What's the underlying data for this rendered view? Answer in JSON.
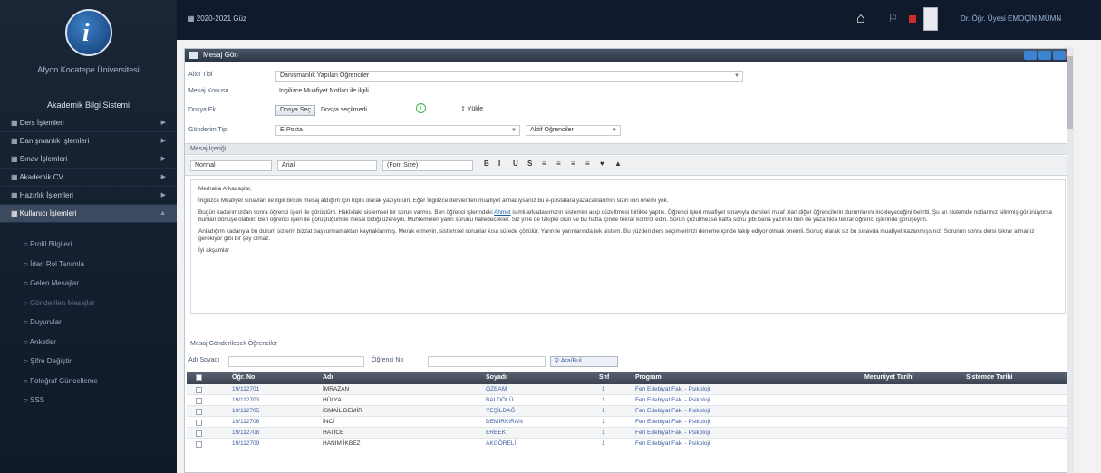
{
  "sidebar": {
    "university": "Afyon Kocatepe Üniversitesi",
    "system_title": "Akademik Bilgi Sistemi",
    "menu": [
      {
        "label": "Ders İşlemleri",
        "active": false
      },
      {
        "label": "Danışmanlık İşlemleri",
        "active": false
      },
      {
        "label": "Sınav İşlemleri",
        "active": false
      },
      {
        "label": "Akademik CV",
        "active": false
      },
      {
        "label": "Hazırlık İşlemleri",
        "active": false
      },
      {
        "label": "Kullanıcı İşlemleri",
        "active": true
      }
    ],
    "submenu": [
      {
        "label": "Profil Bilgileri",
        "dim": false
      },
      {
        "label": "İdari Rol Tanımla",
        "dim": false
      },
      {
        "label": "Gelen Mesajlar",
        "dim": false
      },
      {
        "label": "Gönderilen Mesajlar",
        "dim": true
      },
      {
        "label": "Duyurular",
        "dim": false
      },
      {
        "label": "Anketler",
        "dim": false
      },
      {
        "label": "Şifre Değiştir",
        "dim": false
      },
      {
        "label": "Fotoğraf Güncelleme",
        "dim": false
      },
      {
        "label": "SSS",
        "dim": false
      }
    ]
  },
  "topbar": {
    "term": "2020-2021 Güz",
    "user_name": "Dr. Öğr. Üyesi EMOÇİN MÜMN",
    "icons": [
      "home-icon",
      "notification-icon",
      "flag-icon"
    ]
  },
  "panel": {
    "title": "Mesaj Gön",
    "form": {
      "type_label": "Alıcı Tipi",
      "type_value": "Danışmanlık Yapılan Öğrenciler",
      "subject_label": "Mesaj Konusu",
      "subject_value": "İngilizce Muafiyet Notları ile ilgili",
      "attach_label": "Dosya Ek",
      "choose_button": "Dosya Seç",
      "no_file": "Dosya seçilmedi",
      "upload_button": "Yükle",
      "send_type_label": "Gönderim Tipi",
      "send_type_value": "E-Posta",
      "recipients_value": "Aktif Öğrenciler"
    },
    "editor": {
      "label": "Mesaj İçeriği",
      "format": "Normal",
      "font": "Arial",
      "size": "(Font Size)",
      "tools": [
        "B",
        "I",
        "U",
        "S",
        "≡",
        "≡",
        "≡",
        "≡",
        "♥",
        "▲"
      ],
      "greeting": "Merhaba Arkadaşlar,",
      "p1": "İngilizce Muafiyet sınavları ile ilgili birçok mesaj aldığım için toplu olarak yazıyorum. Eğer İngilizce derslerden muafiyet almadıysanız bu e-postalara yazacaklarımın sizin için önemi yok.",
      "p2a": "Bugün kadarımızdan sonra öğrenci işleri ile görüştüm. Haklıdaki sistemsel bir sorun varmış. Ben öğrenci işlerindeki ",
      "p2link": "Ahmet",
      "p2b": " isimli arkadaşımızın sistemini açıp düzeltmesi birlikte yaptık. Öğrenci işleri muafiyet sınavıyla dersleri muaf olan diğer öğrencilerin durumlarını inceleyeceğini belirtti. Şu an sistemde notlarınız silinmiş görünüyorsa bunları dönüşe olabilir. Ben öğrenci işleri ile görüştüğümde mesai bittiği üzereydi. Muhtemelen yarın sorunu halledecekler. Siz yine de takipte olun ve bu hafta içinde tekrar kontrol edin. Sorun çözülmezse hafta sonu gibi bana yazın ki ben de yazarlıkla tekrar öğrenci işlerinde görüşeyim.",
      "p3": "Anladığım kadarıyla bu durum sizlerin bizzat başvurmamaktan kaynaklanmış. Merak etmeyin, sistemsel sorunlar kısa sürede çözülür. Yarın le yarınlarında tek sistem. Bu yüzden ders seçimlerinizi deneme içinde takip ediyor olmak önemli. Sonuç olarak siz bu sınavda muafiyet kazanmışsınız. Sorunun sonra dersi tekrar almanız gerekiyor gibi bir şey olmaz.",
      "closing": "İyi akşamlar"
    },
    "recipients": {
      "title": "Mesaj Gönderilecek Öğrenciler",
      "name_label": "Adı Soyadı",
      "number_label": "Öğrenci No",
      "search_button": "Ara/Bul",
      "columns": [
        "Öğr. No",
        "Adı",
        "Soyadı",
        "Snf",
        "Program",
        "Mezuniyet Tarihi",
        "Sistemde Tarihi"
      ],
      "rows": [
        {
          "no": "19/112701",
          "name": "İMRAZAN",
          "surname": "ÖZBAM",
          "cls": "1",
          "program": "Fen Edebiyat Fak. - Psikoloji"
        },
        {
          "no": "19/112703",
          "name": "HÜLYA",
          "surname": "BALDÖLÜ",
          "cls": "1",
          "program": "Fen Edebiyat Fak. - Psikoloji"
        },
        {
          "no": "19/112705",
          "name": "İSMAİL DEMİR",
          "surname": "YEŞİLDAĞ",
          "cls": "1",
          "program": "Fen Edebiyat Fak. - Psikoloji"
        },
        {
          "no": "19/112706",
          "name": "İNCİ",
          "surname": "DEMİRKIRAN",
          "cls": "1",
          "program": "Fen Edebiyat Fak. - Psikoloji"
        },
        {
          "no": "19/112708",
          "name": "HATİCE",
          "surname": "ERBEK",
          "cls": "1",
          "program": "Fen Edebiyat Fak. - Psikoloji"
        },
        {
          "no": "19/112709",
          "name": "HANIM İKBEZ",
          "surname": "AKGÖRELİ",
          "cls": "1",
          "program": "Fen Edebiyat Fak. - Psikoloji"
        }
      ]
    }
  },
  "colors": {
    "sidebar_bg": "#111d2c",
    "topbar_bg": "#0f1b2d",
    "header_bg": "#3a4454",
    "link": "#3e5fa3"
  }
}
